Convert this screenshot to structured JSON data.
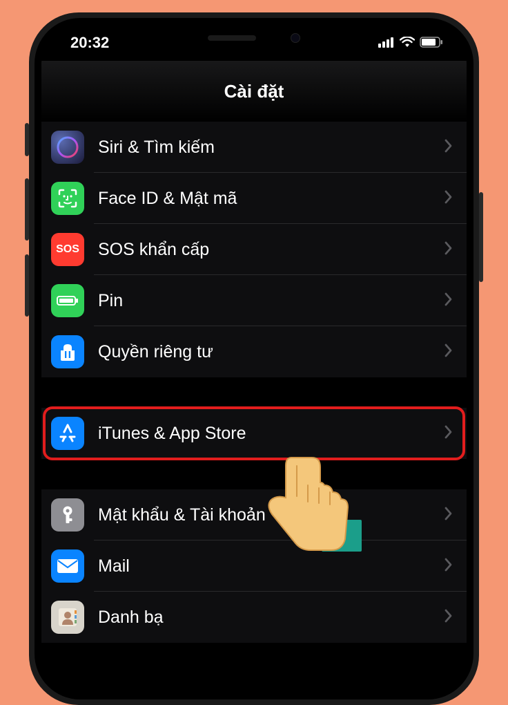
{
  "status": {
    "time": "20:32"
  },
  "header": {
    "title": "Cài đặt"
  },
  "section1": [
    {
      "label": "Siri & Tìm kiếm"
    },
    {
      "label": "Face ID & Mật mã"
    },
    {
      "label": "SOS khẩn cấp",
      "icon_text": "SOS"
    },
    {
      "label": "Pin"
    },
    {
      "label": "Quyền riêng tư"
    }
  ],
  "section2": [
    {
      "label": "iTunes & App Store"
    }
  ],
  "section3": [
    {
      "label": "Mật khẩu & Tài khoản"
    },
    {
      "label": "Mail"
    },
    {
      "label": "Danh bạ"
    }
  ]
}
